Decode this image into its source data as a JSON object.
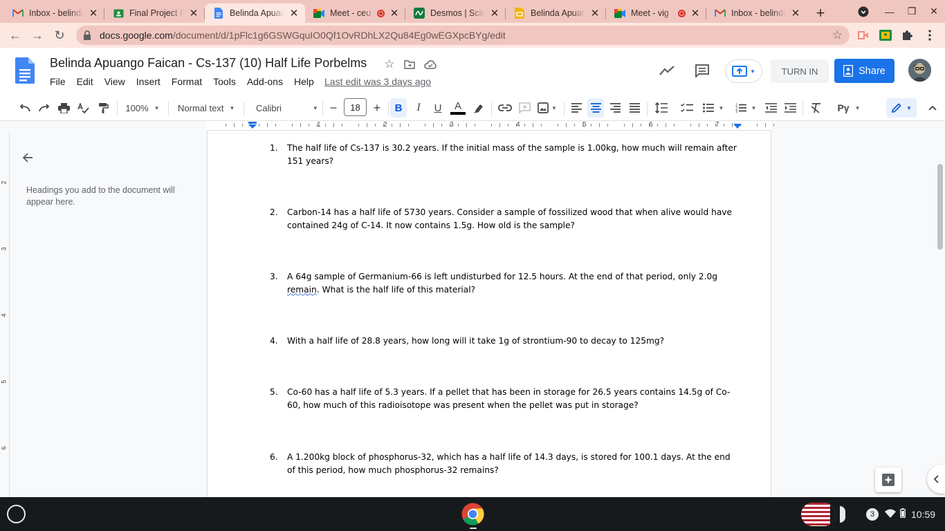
{
  "browser": {
    "tabs": [
      {
        "title": "Inbox - belinda",
        "icon": "gmail-icon",
        "recording": false,
        "active": false
      },
      {
        "title": "Final Project P",
        "icon": "classroom-icon",
        "recording": false,
        "active": false
      },
      {
        "title": "Belinda Apuan",
        "icon": "docs-icon",
        "recording": false,
        "active": true
      },
      {
        "title": "Meet - ceu",
        "icon": "meet-icon",
        "recording": true,
        "active": false
      },
      {
        "title": "Desmos | Scie",
        "icon": "desmos-icon",
        "recording": false,
        "active": false
      },
      {
        "title": "Belinda Apuan",
        "icon": "slides-icon",
        "recording": false,
        "active": false
      },
      {
        "title": "Meet - vig",
        "icon": "meet-icon",
        "recording": true,
        "active": false
      },
      {
        "title": "Inbox - belinda",
        "icon": "gmail-icon",
        "recording": false,
        "active": false
      }
    ],
    "url_host": "docs.google.com",
    "url_path": "/document/d/1pFlc1g6GSWGquIO0Qf1OvRDhLX2Qu84Eg0wEGXpcBYg/edit"
  },
  "doc": {
    "title": "Belinda Apuango Faican - Cs-137  (10) Half Life Porbelms",
    "menus": [
      "File",
      "Edit",
      "View",
      "Insert",
      "Format",
      "Tools",
      "Add-ons",
      "Help"
    ],
    "last_edit": "Last edit was 3 days ago",
    "turn_in_label": "TURN IN",
    "share_label": "Share"
  },
  "format_toolbar": {
    "zoom": "100%",
    "style": "Normal text",
    "font": "Calibri",
    "font_size": "18",
    "editing_mode": "Pγ"
  },
  "ruler": {
    "numbers": [
      "1",
      "2",
      "3",
      "4",
      "5",
      "6",
      "7"
    ],
    "side_numbers": [
      "2",
      "3",
      "4",
      "5",
      "6"
    ]
  },
  "outline": {
    "hint": "Headings you add to the document will appear here."
  },
  "questions": [
    {
      "num": "1.",
      "text": "The half life of Cs-137 is 30.2 years.  If the initial mass of the sample is 1.00kg, how much will remain after 151 years?"
    },
    {
      "num": "2.",
      "text": "Carbon-14 has a half life of 5730 years.  Consider a sample of fossilized wood that when alive would have contained 24g of C-14.  It now contains 1.5g.  How old is the sample?"
    },
    {
      "num": "3.",
      "text_a": "A 64g sample of Germanium-66 is left undisturbed for 12.5 hours.  At the end of that period, only 2.0g ",
      "text_squig": "remain",
      "text_b": ".  What is the half life of this material?"
    },
    {
      "num": "4.",
      "text": "With a half life of 28.8 years, how long will it take 1g of strontium-90 to decay to 125mg?"
    },
    {
      "num": "5.",
      "text": "Co-60 has a half life of 5.3 years.  If a pellet that has been in storage for 26.5 years contains 14.5g of Co-60, how much of this radioisotope was present when the pellet was put in storage?"
    },
    {
      "num": "6.",
      "text": " A 1.200kg block of phosphorus-32, which has a half life of 14.3 days, is stored for 100.1 days. At the end of this period, how much phosphorus-32 remains?"
    }
  ],
  "shelf": {
    "notification_count": "3",
    "time": "10:59"
  },
  "colors": {
    "tabstrip": "#f0c7c0",
    "active_tab": "#fde7e1",
    "share_blue": "#1a73e8",
    "recording_red": "#d93025"
  }
}
